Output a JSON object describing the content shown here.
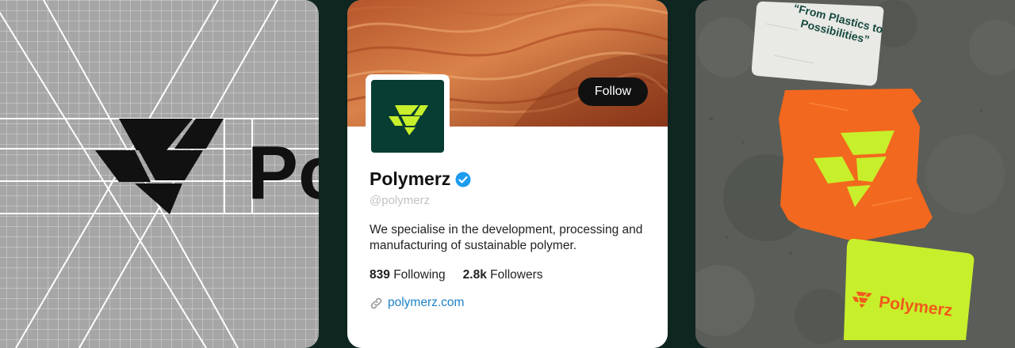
{
  "brand": {
    "name": "Polymerz",
    "colors": {
      "dark_green": "#073d32",
      "lime": "#c8ef2b",
      "orange": "#f2681e",
      "link_blue": "#1d82c8",
      "background": "#0f2520"
    }
  },
  "grid_panel": {
    "wordmark_fragment": "Po"
  },
  "profile": {
    "follow_label": "Follow",
    "display_name": "Polymerz",
    "verified_icon": "verified-badge-icon",
    "handle": "@polymerz",
    "bio": "We specialise in the development, processing and manufacturing of sustainable polymer.",
    "following_count": "839",
    "following_label": "Following",
    "followers_count": "2.8k",
    "followers_label": "Followers",
    "link_icon": "link-icon",
    "website": "polymerz.com"
  },
  "stickers": {
    "quote": "“From Plastics to Possibilities”",
    "lime_sticker_wordmark": "Polymerz"
  }
}
